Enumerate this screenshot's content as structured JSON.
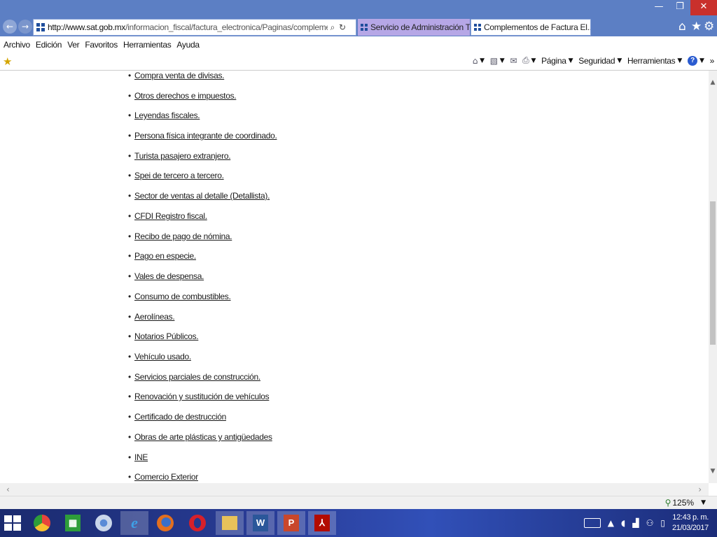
{
  "window": {
    "caption_buttons": {
      "minimize": "—",
      "restore": "❐",
      "close": "✕"
    }
  },
  "address": {
    "url_host": "http://www.sat.gob.mx",
    "url_path": "/informacion_fiscal/factura_electronica/Paginas/complementos_factura_c",
    "search_icon": "⌕",
    "refresh_icon": "↻"
  },
  "tabs": [
    {
      "label": "Servicio de Administración Trib...",
      "active": false
    },
    {
      "label": "Complementos de Factura El...",
      "active": true,
      "close": "×"
    }
  ],
  "toolbar_icons": {
    "home": "⌂",
    "favorites": "★",
    "settings": "⚙"
  },
  "menu": [
    "Archivo",
    "Edición",
    "Ver",
    "Favoritos",
    "Herramientas",
    "Ayuda"
  ],
  "command_bar": {
    "pagina": "Página",
    "seguridad": "Seguridad",
    "herramientas": "Herramientas",
    "help": "?",
    "chevron": "»"
  },
  "content": {
    "items": [
      "Compra venta de divisas.",
      "Otros derechos e impuestos.",
      "Leyendas fiscales.",
      "Persona física integrante de coordinado.",
      "Turista pasajero extranjero.",
      "Spei de tercero a tercero.",
      "Sector de ventas al detalle (Detallista).",
      "CFDI Registro fiscal.",
      "Recibo de pago de nómina.",
      "Pago en especie.",
      "Vales de despensa.",
      "Consumo de combustibles.",
      "Aerolíneas.",
      "Notarios Públicos.",
      "Vehículo usado.",
      "Servicios parciales de construcción.",
      "Renovación y sustitución de vehículos",
      "Certificado de destrucción",
      "Obras de arte plásticas y antigüedades",
      "INE",
      "Comercio Exterior"
    ]
  },
  "status": {
    "zoom": "125%"
  },
  "taskbar": {
    "apps": [
      {
        "name": "chrome",
        "color": "#e8453c"
      },
      {
        "name": "store",
        "color": "#2e9d3a"
      },
      {
        "name": "chrome-alt",
        "color": "#8ab4e8"
      },
      {
        "name": "internet-explorer",
        "color": "#3ea0e6"
      },
      {
        "name": "firefox",
        "color": "#e36f1e"
      },
      {
        "name": "opera",
        "color": "#d6202a"
      },
      {
        "name": "file-explorer",
        "color": "#e8c25a"
      },
      {
        "name": "word",
        "color": "#2b579a",
        "letter": "W"
      },
      {
        "name": "powerpoint",
        "color": "#c9472b",
        "letter": "P"
      },
      {
        "name": "acrobat",
        "color": "#b30b00",
        "letter": "A"
      }
    ],
    "clock_time": "12:43 p. m.",
    "clock_date": "21/03/2017"
  }
}
